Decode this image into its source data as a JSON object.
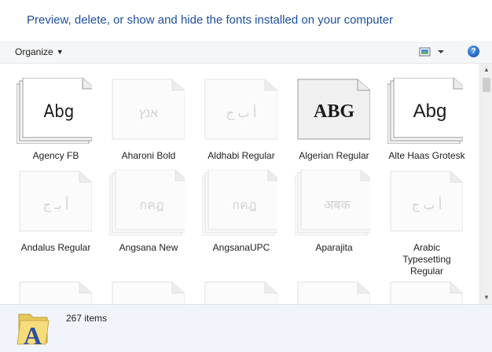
{
  "header": {
    "title": "Preview, delete, or show and hide the fonts installed on your computer"
  },
  "toolbar": {
    "organize_label": "Organize",
    "help_label": "?"
  },
  "fonts": [
    {
      "name": "Agency FB",
      "sample": "Abg",
      "style": "active-stack"
    },
    {
      "name": "Aharoni Bold",
      "sample": "אנץ",
      "style": "hidden-single"
    },
    {
      "name": "Aldhabi Regular",
      "sample": "أ ب ج",
      "style": "hidden-single"
    },
    {
      "name": "Algerian Regular",
      "sample": "ABG",
      "style": "active-single-shaded"
    },
    {
      "name": "Alte Haas Grotesk",
      "sample": "Abg",
      "style": "active-stack"
    },
    {
      "name": "Andalus Regular",
      "sample": "أ بـ ج",
      "style": "hidden-single"
    },
    {
      "name": "Angsana New",
      "sample": "กคฎ",
      "style": "hidden-stack"
    },
    {
      "name": "AngsanaUPC",
      "sample": "กคฎ",
      "style": "hidden-stack"
    },
    {
      "name": "Aparajita",
      "sample": "अबक",
      "style": "hidden-stack"
    },
    {
      "name": "Arabic Typesetting Regular",
      "sample": "أ ب ج",
      "style": "hidden-single"
    }
  ],
  "status": {
    "count": "267 items"
  }
}
